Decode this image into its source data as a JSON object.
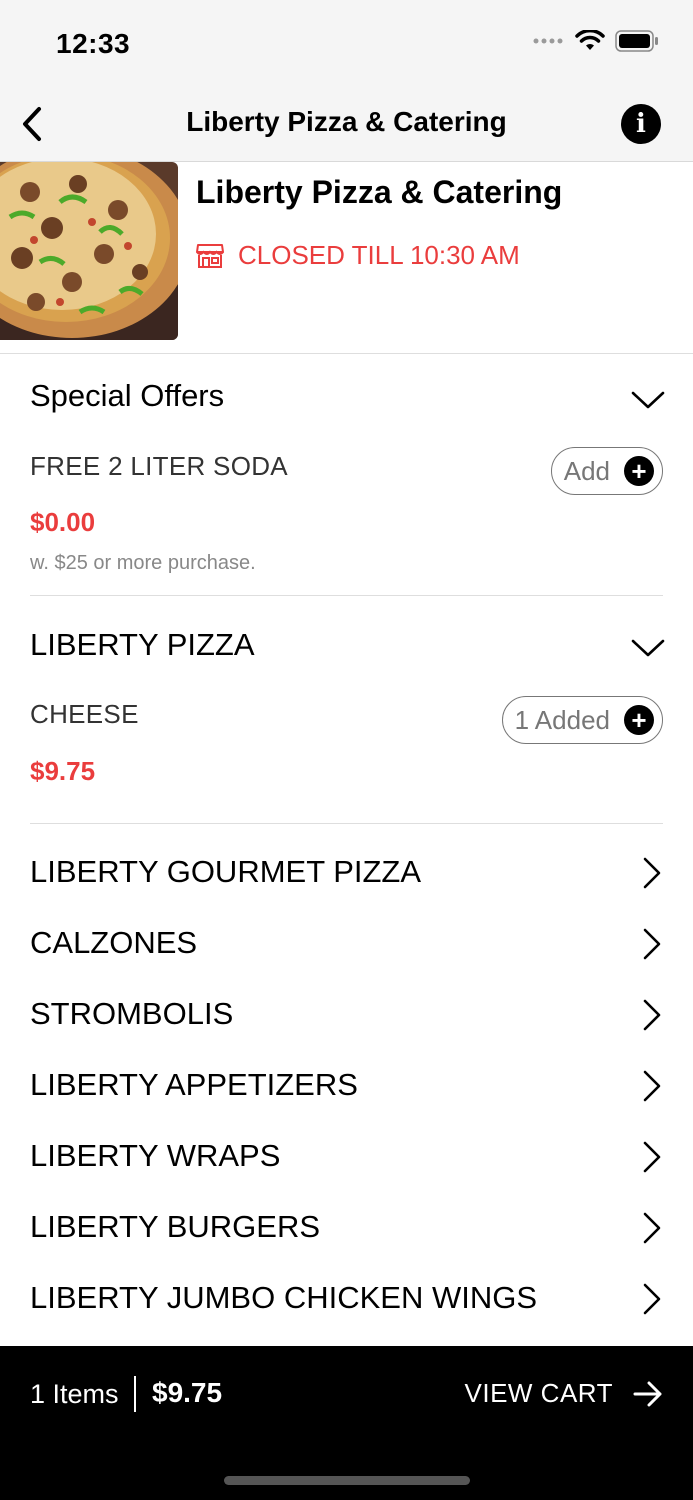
{
  "status_bar": {
    "time": "12:33"
  },
  "nav": {
    "title": "Liberty Pizza & Catering"
  },
  "restaurant": {
    "name": "Liberty Pizza & Catering",
    "status": "CLOSED TILL 10:30 AM",
    "status_color": "#ea3d3d"
  },
  "special_offers": {
    "title": "Special Offers",
    "items": [
      {
        "name": "FREE 2 LITER SODA",
        "price": "$0.00",
        "description": "w. $25 or more purchase.",
        "button_label": "Add"
      }
    ]
  },
  "liberty_pizza": {
    "title": "LIBERTY PIZZA",
    "items": [
      {
        "name": "CHEESE",
        "price": "$9.75",
        "button_label": "1 Added"
      }
    ]
  },
  "categories": [
    "LIBERTY GOURMET PIZZA",
    "CALZONES",
    "STROMBOLIS",
    "LIBERTY APPETIZERS",
    "LIBERTY WRAPS",
    "LIBERTY BURGERS",
    "LIBERTY JUMBO CHICKEN WINGS"
  ],
  "cart": {
    "items_label": "1 Items",
    "total": "$9.75",
    "view_cart_label": "VIEW CART"
  },
  "colors": {
    "accent": "#ea3d3d",
    "bar": "#000000"
  }
}
